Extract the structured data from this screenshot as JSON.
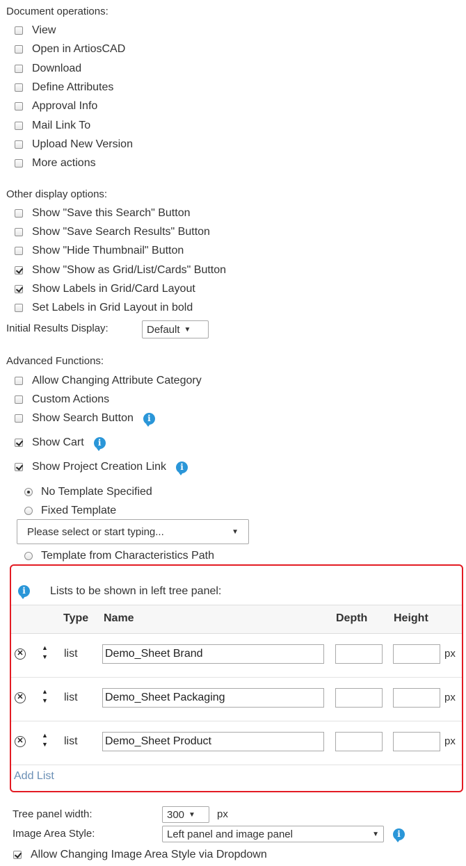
{
  "doc_ops": {
    "title": "Document operations:",
    "items": [
      {
        "label": "View",
        "checked": false
      },
      {
        "label": "Open in ArtiosCAD",
        "checked": false
      },
      {
        "label": "Download",
        "checked": false
      },
      {
        "label": "Define Attributes",
        "checked": false
      },
      {
        "label": "Approval Info",
        "checked": false
      },
      {
        "label": "Mail Link To",
        "checked": false
      },
      {
        "label": "Upload New Version",
        "checked": false
      },
      {
        "label": "More actions",
        "checked": false
      }
    ]
  },
  "display_opts": {
    "title": "Other display options:",
    "items": [
      {
        "label": "Show \"Save this Search\" Button",
        "checked": false
      },
      {
        "label": "Show \"Save Search Results\" Button",
        "checked": false
      },
      {
        "label": "Show \"Hide Thumbnail\" Button",
        "checked": false
      },
      {
        "label": "Show \"Show as Grid/List/Cards\" Button",
        "checked": true
      },
      {
        "label": "Show Labels in Grid/Card Layout",
        "checked": true
      },
      {
        "label": "Set Labels in Grid Layout in bold",
        "checked": false
      }
    ],
    "initial_results_label": "Initial Results Display:",
    "initial_results_value": "Default"
  },
  "advanced": {
    "title": "Advanced Functions:",
    "items": [
      {
        "label": "Allow Changing Attribute Category",
        "checked": false
      },
      {
        "label": "Custom Actions",
        "checked": false
      },
      {
        "label": "Show Search Button",
        "checked": false
      },
      {
        "label": "Show Cart",
        "checked": true
      },
      {
        "label": "Show Project Creation Link",
        "checked": true
      }
    ],
    "radios": [
      {
        "label": "No Template Specified",
        "checked": true
      },
      {
        "label": "Fixed Template",
        "checked": false
      },
      {
        "label": "Template from Characteristics Path",
        "checked": false
      }
    ],
    "template_placeholder": "Please select or start typing..."
  },
  "tree_panel": {
    "title": "Lists to be shown in left tree panel:",
    "headers": {
      "type": "Type",
      "name": "Name",
      "depth": "Depth",
      "height": "Height"
    },
    "rows": [
      {
        "type": "list",
        "name": "Demo_Sheet Brand",
        "depth": "",
        "height": "",
        "unit": "px"
      },
      {
        "type": "list",
        "name": "Demo_Sheet Packaging",
        "depth": "",
        "height": "",
        "unit": "px"
      },
      {
        "type": "list",
        "name": "Demo_Sheet Product",
        "depth": "",
        "height": "",
        "unit": "px"
      }
    ],
    "add_list": "Add List"
  },
  "bottom": {
    "tree_width_label": "Tree panel width:",
    "tree_width_value": "300",
    "tree_width_unit": "px",
    "image_area_label": "Image Area Style:",
    "image_area_value": "Left panel and image panel",
    "allow_change_label": "Allow Changing Image Area Style via Dropdown",
    "allow_change_checked": true
  },
  "colors": {
    "info": "#2a96d8",
    "highlight_border": "#e31b23",
    "link": "#6a8fb5"
  }
}
